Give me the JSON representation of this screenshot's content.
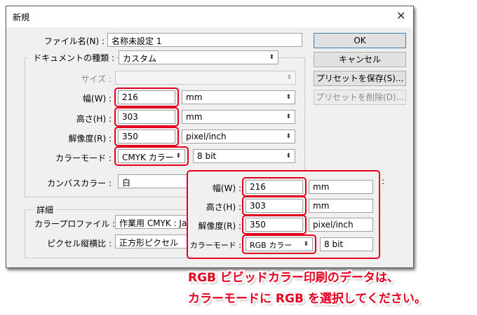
{
  "dialog": {
    "title": "新規",
    "close_glyph": "✕"
  },
  "form": {
    "filename_label": "ファイル名(N) :",
    "filename_value": "名称未設定 1",
    "doctype_label": "ドキュメントの種類 :",
    "doctype_value": "カスタム",
    "size_label": "サイズ :",
    "size_value": "",
    "width_label": "幅(W) :",
    "width_value": "216",
    "width_unit": "mm",
    "height_label": "高さ(H) :",
    "height_value": "303",
    "height_unit": "mm",
    "resolution_label": "解像度(R) :",
    "resolution_value": "350",
    "resolution_unit": "pixel/inch",
    "colormode_label": "カラーモード :",
    "colormode_value": "CMYK カラー",
    "bitdepth_value": "8 bit",
    "canvas_color_label": "カンバスカラー :",
    "canvas_color_value": "白"
  },
  "advanced": {
    "group_label": "詳細",
    "profile_label": "カラープロファイル :",
    "profile_value": "作業用 CMYK : Ja",
    "pixel_ratio_label": "ピクセル縦横比 :",
    "pixel_ratio_value": "正方形ピクセル"
  },
  "buttons": {
    "ok": "OK",
    "cancel": "キャンセル",
    "save_preset": "プリセットを保存(S)...",
    "delete_preset": "プリセットを削除(D)..."
  },
  "popup": {
    "width_label": "幅(W) :",
    "width_value": "216",
    "width_unit": "mm",
    "height_label": "高さ(H) :",
    "height_value": "303",
    "height_unit": "mm",
    "resolution_label": "解像度(R) :",
    "resolution_value": "350",
    "resolution_unit": "pixel/inch",
    "colormode_label": "カラーモード :",
    "colormode_value": "RGB カラー",
    "bitdepth_value": "8 bit",
    "trailing_colon": ":"
  },
  "callout": {
    "line1": "RGB ビビッドカラー印刷のデータは、",
    "line2": "カラーモードに RGB を選択してください。"
  },
  "colors": {
    "highlight": "#e6001f",
    "dialog_bg": "#f0f0f0"
  },
  "icons": {
    "dropdown": "updown-arrow-icon",
    "close": "close-icon"
  }
}
